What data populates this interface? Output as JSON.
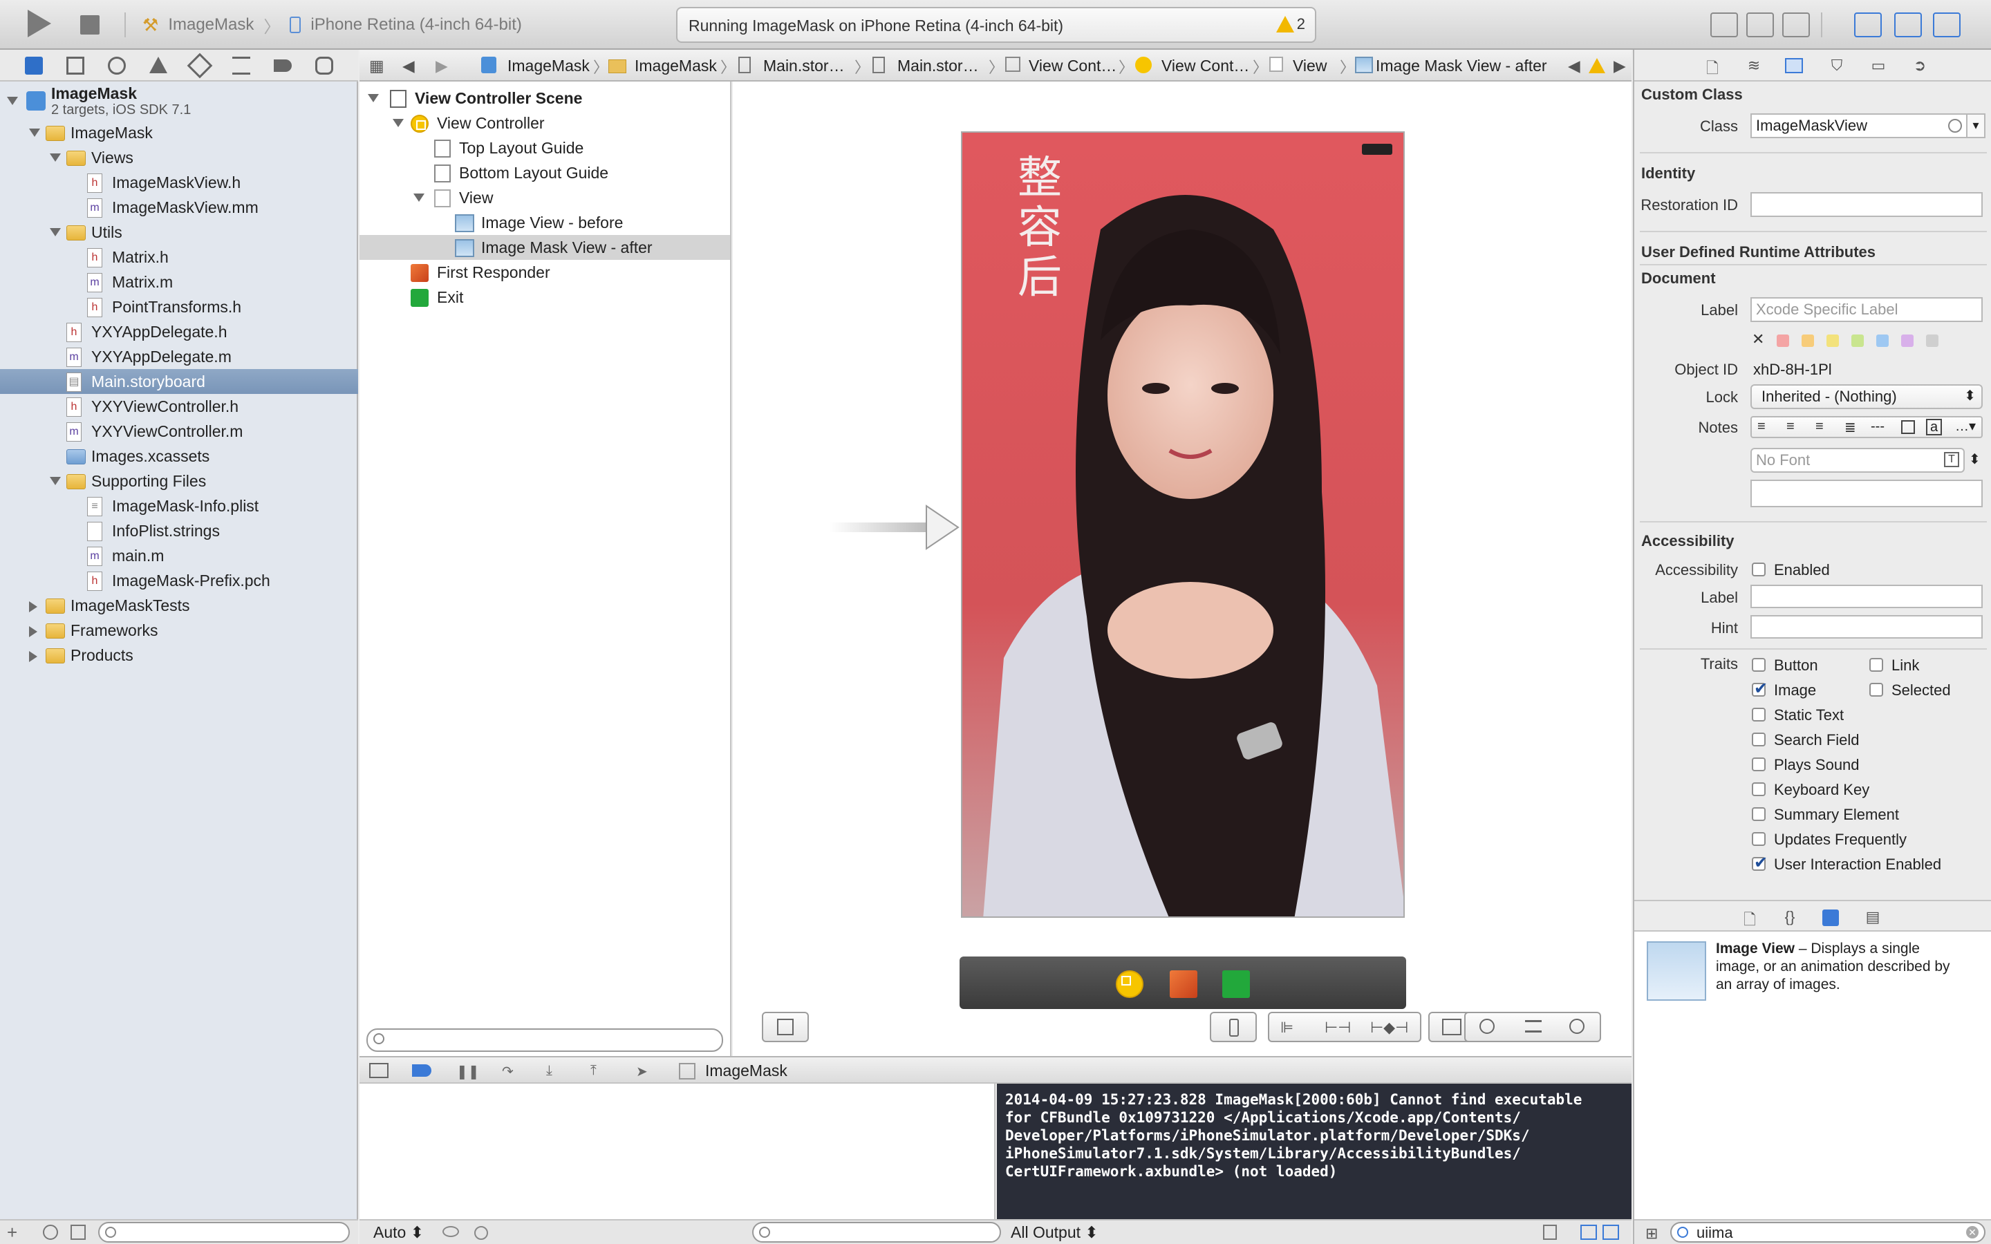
{
  "toolbar": {
    "scheme_project": "ImageMask",
    "scheme_device": "iPhone Retina (4-inch 64-bit)",
    "activity_text": "Running ImageMask on iPhone Retina (4-inch 64-bit)",
    "warning_count": "2"
  },
  "navigator": {
    "project_name": "ImageMask",
    "project_subtitle": "2 targets, iOS SDK 7.1",
    "items": [
      {
        "label": "ImageMask",
        "kind": "folder"
      },
      {
        "label": "Views",
        "kind": "folder"
      },
      {
        "label": "ImageMaskView.h",
        "kind": "h"
      },
      {
        "label": "ImageMaskView.mm",
        "kind": "m"
      },
      {
        "label": "Utils",
        "kind": "folder"
      },
      {
        "label": "Matrix.h",
        "kind": "h"
      },
      {
        "label": "Matrix.m",
        "kind": "m"
      },
      {
        "label": "PointTransforms.h",
        "kind": "h"
      },
      {
        "label": "YXYAppDelegate.h",
        "kind": "h"
      },
      {
        "label": "YXYAppDelegate.m",
        "kind": "m"
      },
      {
        "label": "Main.storyboard",
        "kind": "storyboard"
      },
      {
        "label": "YXYViewController.h",
        "kind": "h"
      },
      {
        "label": "YXYViewController.m",
        "kind": "m"
      },
      {
        "label": "Images.xcassets",
        "kind": "assets"
      },
      {
        "label": "Supporting Files",
        "kind": "folder"
      },
      {
        "label": "ImageMask-Info.plist",
        "kind": "plist"
      },
      {
        "label": "InfoPlist.strings",
        "kind": "plain"
      },
      {
        "label": "main.m",
        "kind": "m"
      },
      {
        "label": "ImageMask-Prefix.pch",
        "kind": "h"
      },
      {
        "label": "ImageMaskTests",
        "kind": "folder"
      },
      {
        "label": "Frameworks",
        "kind": "folder"
      },
      {
        "label": "Products",
        "kind": "folder"
      }
    ]
  },
  "jumpbar": {
    "items": [
      "ImageMask",
      "ImageMask",
      "Main.stor…",
      "Main.stor…",
      "View Cont…",
      "View Cont…",
      "View",
      "Image Mask View - after"
    ]
  },
  "outline": {
    "items": [
      "View Controller Scene",
      "View Controller",
      "Top Layout Guide",
      "Bottom Layout Guide",
      "View",
      "Image View - before",
      "Image Mask View - after",
      "First Responder",
      "Exit"
    ]
  },
  "canvas": {
    "overlay_text": "整容后"
  },
  "debug": {
    "target": "ImageMask",
    "console_text": "2014-04-09 15:27:23.828 ImageMask[2000:60b] Cannot find executable\nfor CFBundle 0x109731220 </Applications/Xcode.app/Contents/\nDeveloper/Platforms/iPhoneSimulator.platform/Developer/SDKs/\niPhoneSimulator7.1.sdk/System/Library/AccessibilityBundles/\nCertUIFramework.axbundle> (not loaded)",
    "auto_label": "Auto ⬍",
    "output_label": "All Output ⬍"
  },
  "inspector": {
    "custom_class": {
      "title": "Custom Class",
      "class_label": "Class",
      "class_value": "ImageMaskView"
    },
    "identity": {
      "title": "Identity",
      "restoration_label": "Restoration ID",
      "runtime_title": "User Defined Runtime Attributes"
    },
    "document": {
      "title": "Document",
      "label_label": "Label",
      "label_placeholder": "Xcode Specific Label",
      "object_id_label": "Object ID",
      "object_id_value": "xhD-8H-1Pl",
      "lock_label": "Lock",
      "lock_value": "Inherited - (Nothing)",
      "notes_label": "Notes",
      "font_placeholder": "No Font",
      "swatch_colors": [
        "#f4a4a4",
        "#f7cc7a",
        "#f3e27c",
        "#c9e58f",
        "#9ec8f2",
        "#d8b0ea",
        "#cfcfcf"
      ]
    },
    "accessibility": {
      "title": "Accessibility",
      "accessibility_label": "Accessibility",
      "enabled_label": "Enabled",
      "label_label": "Label",
      "hint_label": "Hint",
      "traits_label": "Traits",
      "traits": [
        {
          "label": "Button",
          "checked": false
        },
        {
          "label": "Link",
          "checked": false
        },
        {
          "label": "Image",
          "checked": true
        },
        {
          "label": "Selected",
          "checked": false
        },
        {
          "label": "Static Text",
          "checked": false
        },
        {
          "label": "Search Field",
          "checked": false
        },
        {
          "label": "Plays Sound",
          "checked": false
        },
        {
          "label": "Keyboard Key",
          "checked": false
        },
        {
          "label": "Summary Element",
          "checked": false
        },
        {
          "label": "Updates Frequently",
          "checked": false
        },
        {
          "label": "User Interaction Enabled",
          "checked": true
        }
      ]
    }
  },
  "library": {
    "item_title": "Image View",
    "item_desc_1": " – Displays a single",
    "item_desc_2": "image, or an animation described by",
    "item_desc_3": "an array of images.",
    "filter_value": "uiima"
  }
}
